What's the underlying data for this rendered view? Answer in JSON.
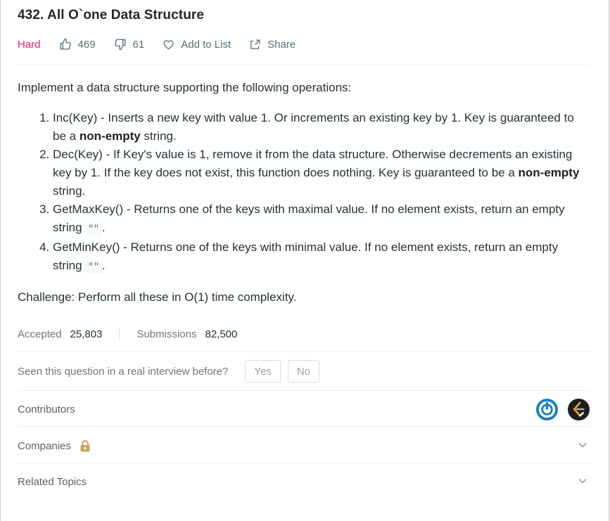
{
  "problem": {
    "title": "432. All O`one Data Structure",
    "difficulty": "Hard",
    "likes": "469",
    "dislikes": "61",
    "add_to_list_label": "Add to List",
    "share_label": "Share"
  },
  "description": {
    "intro": "Implement a data structure supporting the following operations:",
    "operations": [
      {
        "pre": "Inc(Key) - Inserts a new key with value 1. Or increments an existing key by 1. Key is guaranteed to be a ",
        "bold": "non-empty",
        "post": " string."
      },
      {
        "pre": "Dec(Key) - If Key's value is 1, remove it from the data structure. Otherwise decrements an existing key by 1. If the key does not exist, this function does nothing. Key is guaranteed to be a ",
        "bold": "non-empty",
        "post": " string."
      },
      {
        "pre": "GetMaxKey() - Returns one of the keys with maximal value. If no element exists, return an empty string ",
        "code": "\"\"",
        "post": "."
      },
      {
        "pre": "GetMinKey() - Returns one of the keys with minimal value. If no element exists, return an empty string ",
        "code": "\"\"",
        "post": "."
      }
    ],
    "challenge": "Challenge: Perform all these in O(1) time complexity."
  },
  "stats": {
    "accepted_label": "Accepted",
    "accepted_value": "25,803",
    "submissions_label": "Submissions",
    "submissions_value": "82,500"
  },
  "interview": {
    "question": "Seen this question in a real interview before?",
    "yes_label": "Yes",
    "no_label": "No"
  },
  "sections": {
    "contributors": "Contributors",
    "companies": "Companies",
    "related_topics": "Related Topics"
  },
  "colors": {
    "difficulty_hard": "#e91e63",
    "lock": "#c9a45c",
    "avatar_blue": "#1a7fc1",
    "avatar_dark": "#1e1e1e"
  },
  "icons": [
    "thumbs-up-icon",
    "thumbs-down-icon",
    "heart-icon",
    "share-icon",
    "lock-icon",
    "chevron-down-icon"
  ]
}
